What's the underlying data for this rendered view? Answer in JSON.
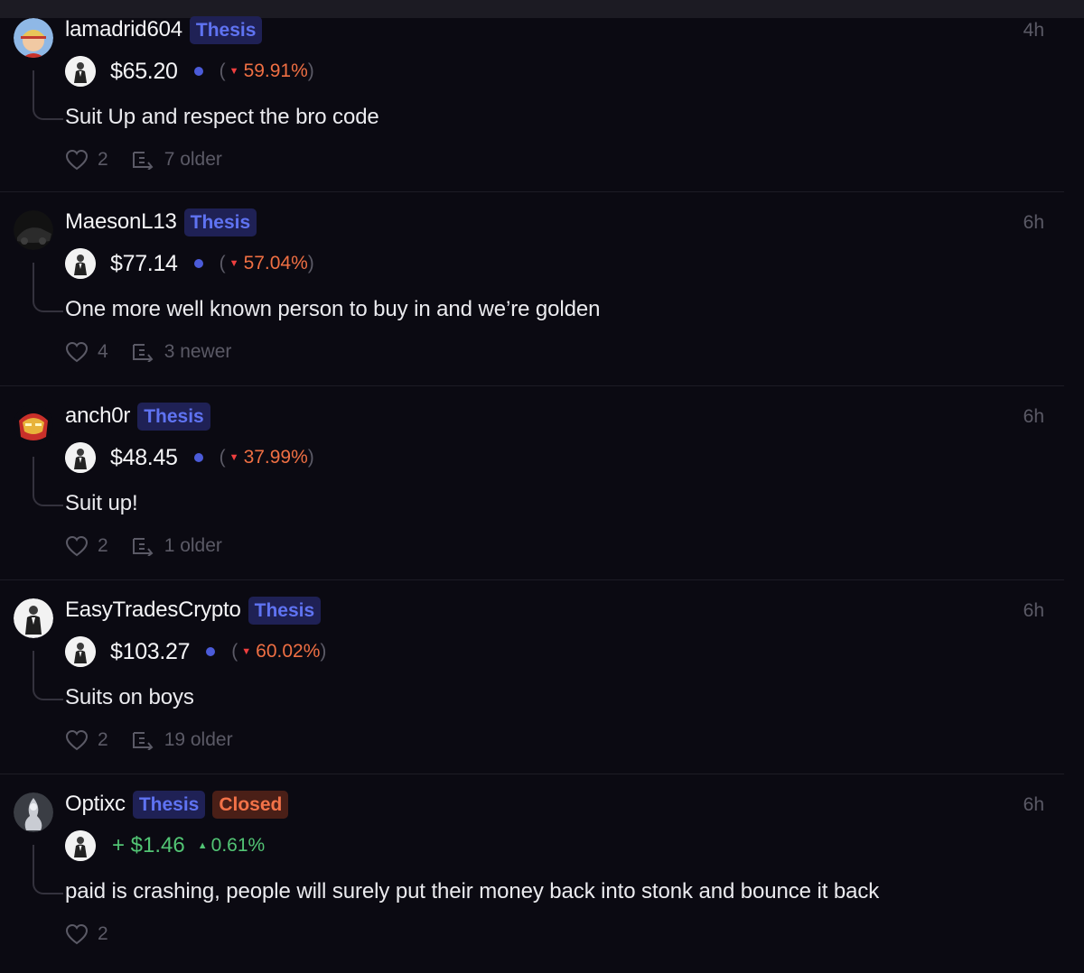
{
  "posts": [
    {
      "username": "lamadrid604",
      "badges": [
        "Thesis"
      ],
      "time": "4h",
      "price": "$65.20",
      "change": "59.91%",
      "text": "Suit Up and respect the bro code",
      "likes": "2",
      "thread": "7 older"
    },
    {
      "username": "MaesonL13",
      "badges": [
        "Thesis"
      ],
      "time": "6h",
      "price": "$77.14",
      "change": "57.04%",
      "text": "One more well known person to buy in and we’re golden",
      "likes": "4",
      "thread": "3 newer"
    },
    {
      "username": "anch0r",
      "badges": [
        "Thesis"
      ],
      "time": "6h",
      "price": "$48.45",
      "change": "37.99%",
      "text": "Suit up!",
      "likes": "2",
      "thread": "1 older"
    },
    {
      "username": "EasyTradesCrypto",
      "badges": [
        "Thesis"
      ],
      "time": "6h",
      "price": "$103.27",
      "change": "60.02%",
      "text": "Suits on boys",
      "likes": "2",
      "thread": "19 older"
    },
    {
      "username": "Optixc",
      "badges": [
        "Thesis",
        "Closed"
      ],
      "time": "6h",
      "price": "+ $1.46",
      "change": "0.61%",
      "text": "paid is crashing, people will surely put their money back into stonk and bounce it back",
      "likes": "2",
      "thread": ""
    }
  ],
  "colors": {
    "background": "#0b0a12",
    "thesis": "#5f73f2",
    "closed": "#f27248",
    "negative": "#ef6f43",
    "positive": "#52c474",
    "muted": "#5b5a66"
  },
  "icons": {
    "like": "heart-icon",
    "thread": "thread-icon",
    "token": "suited-man-token-icon"
  }
}
